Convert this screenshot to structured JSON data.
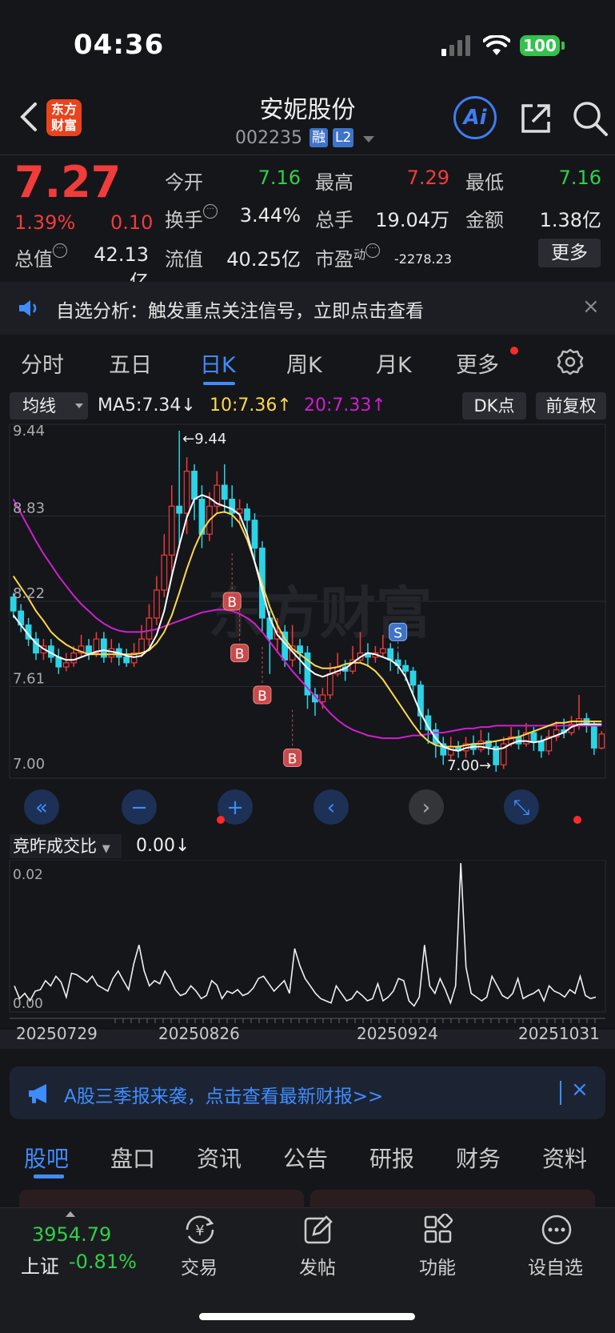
{
  "status": {
    "time": "04:36",
    "battery": "100"
  },
  "header": {
    "logo": [
      "东方",
      "财富"
    ],
    "name": "安妮股份",
    "code": "002235",
    "tag1": "融",
    "tag2": "L2",
    "ai": "Ai"
  },
  "quote": {
    "price": "7.27",
    "pct": "1.39%",
    "change": "0.10",
    "rows": [
      [
        {
          "label": "今开",
          "value": "7.16",
          "color": "green"
        },
        {
          "label": "最高",
          "value": "7.29",
          "color": "red"
        },
        {
          "label": "最低",
          "value": "7.16",
          "color": "green"
        }
      ],
      [
        {
          "label": "换手",
          "value": "3.44%",
          "color": "white"
        },
        {
          "label": "总手",
          "value": "19.04万",
          "color": "white"
        },
        {
          "label": "金额",
          "value": "1.38亿",
          "color": "white"
        }
      ],
      [
        {
          "label": "总值",
          "value": "42.13亿",
          "color": "white"
        },
        {
          "label": "流值",
          "value": "40.25亿",
          "color": "white"
        },
        {
          "label": "市盈",
          "value": "-2278.23",
          "color": "white"
        }
      ]
    ],
    "pe_sup": "动",
    "more": "更多"
  },
  "notice": {
    "text": "自选分析：触发重点关注信号，立即点击查看",
    "close": "×"
  },
  "tabs": [
    "分时",
    "五日",
    "日K",
    "周K",
    "月K",
    "更多"
  ],
  "active_tab": "日K",
  "indicators": {
    "select": "均线",
    "ma5": "MA5:7.34↓",
    "ma10": "10:7.36↑",
    "ma20": "20:7.33↑",
    "dk": "DK点",
    "fq": "前复权"
  },
  "chart_controls": [
    "«",
    "−",
    "+",
    "‹",
    "›",
    "⤡"
  ],
  "watermark": "东方财富",
  "chart_data": [
    {
      "type": "candlestick",
      "y_ticks": [
        "9.44",
        "8.83",
        "8.22",
        "7.61",
        "7.00"
      ],
      "ylim": [
        7.0,
        9.44
      ],
      "high_label": "←9.44",
      "low_label": "7.00→",
      "colors": {
        "up": "#f23b3b",
        "down": "#2ad4e6",
        "ma5": "#ffffff",
        "ma10": "#ffd84a",
        "ma20": "#d01fd0"
      },
      "candles": [
        [
          8.25,
          8.15,
          8.28,
          8.1
        ],
        [
          8.15,
          8.05,
          8.2,
          8.0
        ],
        [
          8.05,
          7.95,
          8.1,
          7.9
        ],
        [
          7.95,
          7.85,
          8.0,
          7.8
        ],
        [
          7.85,
          7.9,
          7.95,
          7.8
        ],
        [
          7.9,
          7.82,
          7.95,
          7.78
        ],
        [
          7.82,
          7.75,
          7.88,
          7.7
        ],
        [
          7.75,
          7.78,
          7.85,
          7.72
        ],
        [
          7.78,
          7.85,
          7.9,
          7.75
        ],
        [
          7.85,
          7.9,
          7.98,
          7.82
        ],
        [
          7.9,
          7.85,
          7.95,
          7.8
        ],
        [
          7.85,
          7.95,
          8.0,
          7.82
        ],
        [
          7.95,
          7.82,
          8.0,
          7.78
        ],
        [
          7.82,
          7.88,
          7.95,
          7.78
        ],
        [
          7.88,
          7.82,
          7.92,
          7.76
        ],
        [
          7.82,
          7.78,
          7.88,
          7.75
        ],
        [
          7.78,
          7.85,
          7.92,
          7.75
        ],
        [
          7.85,
          7.95,
          8.05,
          7.82
        ],
        [
          7.95,
          8.1,
          8.2,
          7.9
        ],
        [
          8.1,
          8.3,
          8.4,
          8.05
        ],
        [
          8.3,
          8.55,
          8.7,
          8.25
        ],
        [
          8.55,
          8.9,
          9.05,
          8.4
        ],
        [
          8.9,
          8.85,
          9.44,
          8.6
        ],
        [
          8.85,
          9.15,
          9.25,
          8.7
        ],
        [
          9.15,
          8.95,
          9.2,
          8.8
        ],
        [
          8.95,
          8.7,
          9.05,
          8.6
        ],
        [
          8.7,
          8.9,
          9.0,
          8.65
        ],
        [
          8.9,
          9.05,
          9.15,
          8.85
        ],
        [
          9.05,
          8.95,
          9.2,
          8.85
        ],
        [
          8.95,
          8.85,
          9.05,
          8.75
        ],
        [
          8.85,
          8.88,
          8.95,
          8.78
        ],
        [
          8.88,
          8.8,
          8.92,
          8.7
        ],
        [
          8.8,
          8.6,
          8.85,
          8.5
        ],
        [
          8.6,
          8.1,
          8.65,
          8.0
        ],
        [
          8.1,
          7.95,
          8.15,
          7.7
        ],
        [
          7.95,
          8.0,
          8.1,
          7.85
        ],
        [
          8.0,
          7.8,
          8.05,
          7.75
        ],
        [
          7.8,
          7.9,
          8.05,
          7.75
        ],
        [
          7.9,
          7.85,
          7.95,
          7.7
        ],
        [
          7.85,
          7.55,
          7.9,
          7.45
        ],
        [
          7.55,
          7.5,
          7.6,
          7.4
        ],
        [
          7.5,
          7.55,
          7.6,
          7.45
        ],
        [
          7.55,
          7.7,
          7.78,
          7.52
        ],
        [
          7.7,
          7.75,
          7.85,
          7.68
        ],
        [
          7.75,
          7.72,
          7.8,
          7.65
        ],
        [
          7.72,
          7.8,
          7.9,
          7.7
        ],
        [
          7.8,
          7.85,
          8.0,
          7.78
        ],
        [
          7.85,
          7.82,
          7.92,
          7.75
        ],
        [
          7.82,
          7.85,
          7.9,
          7.78
        ],
        [
          7.85,
          7.88,
          7.98,
          7.82
        ],
        [
          7.88,
          7.8,
          7.92,
          7.72
        ],
        [
          7.8,
          7.76,
          7.85,
          7.7
        ],
        [
          7.76,
          7.72,
          7.8,
          7.65
        ],
        [
          7.72,
          7.62,
          7.75,
          7.55
        ],
        [
          7.62,
          7.4,
          7.65,
          7.3
        ],
        [
          7.4,
          7.3,
          7.45,
          7.2
        ],
        [
          7.3,
          7.2,
          7.35,
          7.1
        ],
        [
          7.2,
          7.12,
          7.25,
          7.05
        ],
        [
          7.12,
          7.18,
          7.25,
          7.08
        ],
        [
          7.18,
          7.15,
          7.22,
          7.1
        ],
        [
          7.15,
          7.2,
          7.25,
          7.1
        ],
        [
          7.2,
          7.16,
          7.26,
          7.12
        ],
        [
          7.16,
          7.22,
          7.3,
          7.14
        ],
        [
          7.22,
          7.18,
          7.28,
          7.12
        ],
        [
          7.18,
          7.05,
          7.22,
          7.0
        ],
        [
          7.05,
          7.2,
          7.25,
          7.02
        ],
        [
          7.2,
          7.25,
          7.32,
          7.18
        ],
        [
          7.25,
          7.2,
          7.3,
          7.16
        ],
        [
          7.2,
          7.28,
          7.35,
          7.18
        ],
        [
          7.28,
          7.22,
          7.32,
          7.15
        ],
        [
          7.22,
          7.15,
          7.26,
          7.1
        ],
        [
          7.15,
          7.25,
          7.3,
          7.12
        ],
        [
          7.25,
          7.3,
          7.36,
          7.22
        ],
        [
          7.3,
          7.28,
          7.38,
          7.24
        ],
        [
          7.28,
          7.34,
          7.4,
          7.26
        ],
        [
          7.34,
          7.38,
          7.55,
          7.3
        ],
        [
          7.38,
          7.33,
          7.42,
          7.28
        ],
        [
          7.33,
          7.17,
          7.36,
          7.12
        ],
        [
          7.17,
          7.27,
          7.29,
          7.16
        ]
      ],
      "ma5": [
        8.12,
        8.05,
        7.98,
        7.92,
        7.88,
        7.85,
        7.82,
        7.8,
        7.8,
        7.82,
        7.84,
        7.86,
        7.87,
        7.86,
        7.85,
        7.83,
        7.82,
        7.83,
        7.88,
        7.98,
        8.15,
        8.4,
        8.62,
        8.82,
        8.95,
        8.98,
        8.96,
        8.92,
        8.9,
        8.88,
        8.84,
        8.7,
        8.5,
        8.3,
        8.1,
        7.98,
        7.92,
        7.86,
        7.8,
        7.74,
        7.7,
        7.68,
        7.7,
        7.72,
        7.74,
        7.78,
        7.82,
        7.85,
        7.84,
        7.82,
        7.8,
        7.76,
        7.68,
        7.55,
        7.42,
        7.32,
        7.24,
        7.18,
        7.16,
        7.15,
        7.17,
        7.18,
        7.18,
        7.17,
        7.16,
        7.17,
        7.2,
        7.22,
        7.22,
        7.21,
        7.22,
        7.24,
        7.26,
        7.28,
        7.32,
        7.34,
        7.34,
        7.34,
        7.34
      ],
      "ma10": [
        8.4,
        8.32,
        8.24,
        8.15,
        8.08,
        8.0,
        7.95,
        7.91,
        7.88,
        7.86,
        7.84,
        7.84,
        7.84,
        7.84,
        7.84,
        7.84,
        7.84,
        7.85,
        7.87,
        7.92,
        8.0,
        8.12,
        8.28,
        8.45,
        8.6,
        8.72,
        8.8,
        8.85,
        8.86,
        8.84,
        8.78,
        8.66,
        8.5,
        8.34,
        8.18,
        8.05,
        7.95,
        7.88,
        7.84,
        7.8,
        7.76,
        7.74,
        7.74,
        7.75,
        7.77,
        7.78,
        7.78,
        7.76,
        7.72,
        7.66,
        7.58,
        7.5,
        7.42,
        7.34,
        7.27,
        7.22,
        7.19,
        7.18,
        7.18,
        7.18,
        7.19,
        7.2,
        7.2,
        7.21,
        7.22,
        7.23,
        7.24,
        7.25,
        7.27,
        7.29,
        7.31,
        7.33,
        7.35,
        7.35,
        7.36,
        7.36,
        7.36,
        7.36,
        7.36
      ],
      "ma20": [
        8.95,
        8.85,
        8.75,
        8.65,
        8.56,
        8.48,
        8.4,
        8.33,
        8.26,
        8.2,
        8.15,
        8.1,
        8.06,
        8.03,
        8.01,
        8.0,
        8.0,
        8.0,
        8.01,
        8.02,
        8.04,
        8.06,
        8.08,
        8.1,
        8.12,
        8.14,
        8.15,
        8.16,
        8.16,
        8.15,
        8.13,
        8.1,
        8.06,
        8.0,
        7.93,
        7.86,
        7.79,
        7.72,
        7.66,
        7.6,
        7.54,
        7.48,
        7.42,
        7.37,
        7.33,
        7.3,
        7.28,
        7.26,
        7.25,
        7.24,
        7.24,
        7.24,
        7.25,
        7.26,
        7.26,
        7.27,
        7.28,
        7.28,
        7.29,
        7.3,
        7.31,
        7.31,
        7.32,
        7.32,
        7.33,
        7.33,
        7.33,
        7.33,
        7.33,
        7.33,
        7.33,
        7.33,
        7.33,
        7.33,
        7.33,
        7.33,
        7.33,
        7.33,
        7.33
      ],
      "signals": [
        {
          "label": "B",
          "index": 29,
          "price": 8.22
        },
        {
          "label": "B",
          "index": 30,
          "price": 7.85
        },
        {
          "label": "B",
          "index": 33,
          "price": 7.55
        },
        {
          "label": "B",
          "index": 37,
          "price": 7.1
        },
        {
          "label": "S",
          "index": 51,
          "price": 8.0
        }
      ]
    },
    {
      "type": "line",
      "title": "竞昨成交比",
      "value_label": "0.00↓",
      "y_ticks": [
        "0.02",
        "0.00"
      ],
      "ylim": [
        0,
        0.02
      ],
      "x_ticks": [
        "20250729",
        "20250826",
        "20250924",
        "20251031"
      ],
      "values": [
        0.0035,
        0.0018,
        0.0025,
        0.0015,
        0.0028,
        0.003,
        0.0042,
        0.0035,
        0.0048,
        0.004,
        0.002,
        0.0052,
        0.005,
        0.0045,
        0.004,
        0.0048,
        0.0036,
        0.0032,
        0.0028,
        0.0045,
        0.0055,
        0.0042,
        0.003,
        0.0065,
        0.009,
        0.0055,
        0.0035,
        0.0042,
        0.0038,
        0.0055,
        0.0045,
        0.003,
        0.0022,
        0.0025,
        0.0035,
        0.0028,
        0.0018,
        0.0022,
        0.0042,
        0.0036,
        0.0018,
        0.0028,
        0.0025,
        0.003,
        0.0022,
        0.0025,
        0.0032,
        0.0045,
        0.0048,
        0.0038,
        0.0028,
        0.0035,
        0.0042,
        0.0025,
        0.0085,
        0.0062,
        0.0045,
        0.0035,
        0.0025,
        0.0018,
        0.0015,
        0.0012,
        0.0035,
        0.0025,
        0.0015,
        0.0018,
        0.0028,
        0.0022,
        0.0015,
        0.0018,
        0.0038,
        0.0015,
        0.002,
        0.0028,
        0.0045,
        0.0042,
        0.0015,
        0.0008,
        0.002,
        0.009,
        0.0035,
        0.0025,
        0.0045,
        0.003,
        0.0012,
        0.0035,
        0.02,
        0.006,
        0.0025,
        0.002,
        0.0015,
        0.002,
        0.0048,
        0.0035,
        0.0022,
        0.0018,
        0.0025,
        0.0045,
        0.0018,
        0.0022,
        0.0025,
        0.003,
        0.0015,
        0.0035,
        0.0028,
        0.0025,
        0.002,
        0.003,
        0.0025,
        0.0048,
        0.0022,
        0.0018,
        0.002
      ]
    }
  ],
  "banner": {
    "text": "A股三季报来袭，点击查看最新财报>>",
    "close": "×"
  },
  "bottom_tabs": [
    "股吧",
    "盘口",
    "资讯",
    "公告",
    "研报",
    "财务",
    "资料"
  ],
  "nav": {
    "index_value": "3954.79",
    "index_name": "上证",
    "index_pct": "-0.81%",
    "items": [
      "交易",
      "发帖",
      "功能",
      "设自选"
    ]
  }
}
